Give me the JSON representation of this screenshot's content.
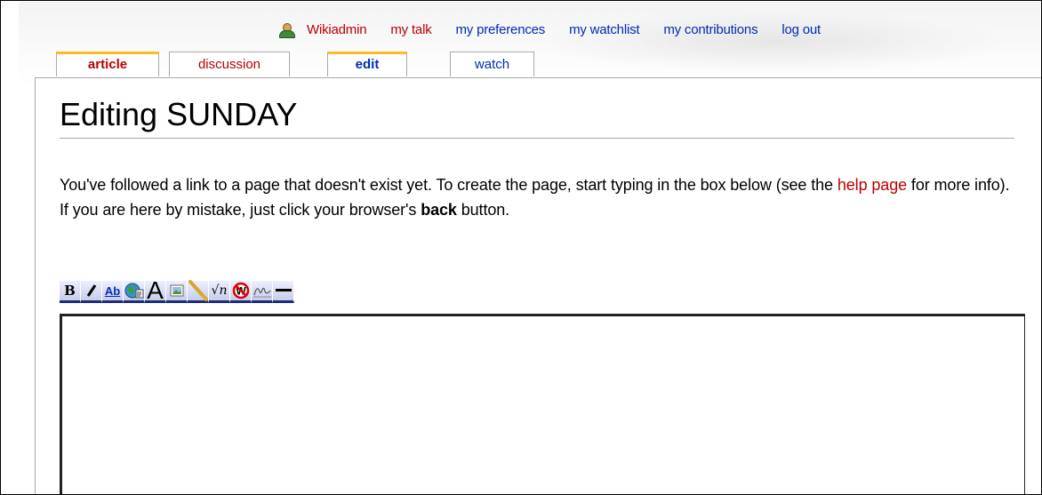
{
  "personal_tools": {
    "username": "Wikiadmin",
    "my_talk": "my talk",
    "my_preferences": "my preferences",
    "my_watchlist": "my watchlist",
    "my_contributions": "my contributions",
    "log_out": "log out"
  },
  "tabs": {
    "article": "article",
    "discussion": "discussion",
    "edit": "edit",
    "watch": "watch"
  },
  "page": {
    "title": "Editing SUNDAY",
    "intro_part1": "You've followed a link to a page that doesn't exist yet. To create the page, start typing in the box below (see the ",
    "help_link": "help page",
    "intro_part2": " for more info). If you are here by mistake, just click your browser's ",
    "back_word": "back",
    "intro_part3": " button."
  },
  "toolbar": {
    "items": [
      {
        "name": "bold-icon",
        "label": "B"
      },
      {
        "name": "italic-icon",
        "label": "I"
      },
      {
        "name": "internal-link-icon",
        "label": "Ab"
      },
      {
        "name": "external-link-icon",
        "label": ""
      },
      {
        "name": "headline-icon",
        "label": "A"
      },
      {
        "name": "image-icon",
        "label": ""
      },
      {
        "name": "media-icon",
        "label": ""
      },
      {
        "name": "math-icon",
        "label": "√n"
      },
      {
        "name": "nowiki-icon",
        "label": "W"
      },
      {
        "name": "signature-icon",
        "label": ""
      },
      {
        "name": "horizontal-line-icon",
        "label": ""
      }
    ]
  },
  "editor": {
    "value": ""
  },
  "colors": {
    "link": "#002bb8",
    "new_link": "#ba0000",
    "tab_selected_border": "#fabd23",
    "toolbar_underline": "#1c2a80"
  }
}
